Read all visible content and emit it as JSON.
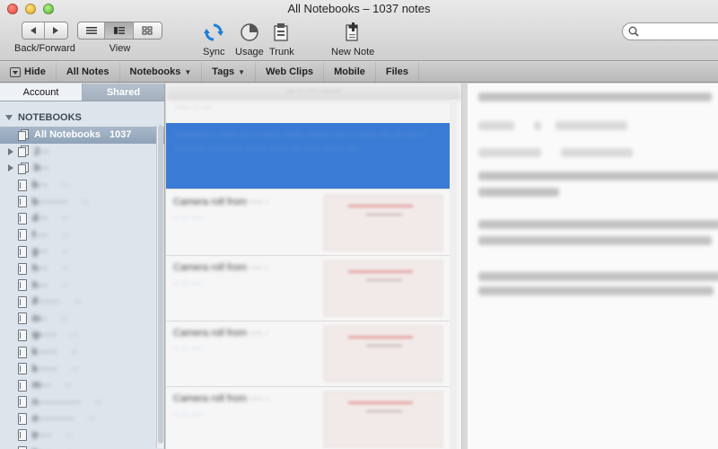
{
  "window": {
    "title": "All Notebooks – 1037 notes"
  },
  "toolbar": {
    "back_forward_label": "Back/Forward",
    "view_label": "View",
    "sync_label": "Sync",
    "usage_label": "Usage",
    "trunk_label": "Trunk",
    "new_note_label": "New Note"
  },
  "tabbar": {
    "hide": "Hide",
    "all_notes": "All Notes",
    "notebooks": "Notebooks",
    "tags": "Tags",
    "web_clips": "Web Clips",
    "mobile": "Mobile",
    "files": "Files"
  },
  "sidebar": {
    "tab_account": "Account",
    "tab_shared": "Shared",
    "section_title": "NOTEBOOKS",
    "selected_notebook": "All Notebooks",
    "selected_count": "1037",
    "notebooks": [
      {
        "name": "2···",
        "count": "",
        "stack": true
      },
      {
        "name": "b···",
        "count": "",
        "stack": true
      },
      {
        "name": "b···",
        "count": "··"
      },
      {
        "name": "b·········",
        "count": "··"
      },
      {
        "name": "d···",
        "count": "··"
      },
      {
        "name": "f····",
        "count": "··"
      },
      {
        "name": "g···",
        "count": "··"
      },
      {
        "name": "h···",
        "count": "··"
      },
      {
        "name": "h···",
        "count": "··"
      },
      {
        "name": "if·······",
        "count": "··"
      },
      {
        "name": "in··",
        "count": "··"
      },
      {
        "name": "ip·····",
        "count": "··"
      },
      {
        "name": "k······",
        "count": "··"
      },
      {
        "name": "k······",
        "count": "··"
      },
      {
        "name": "m···",
        "count": "··"
      },
      {
        "name": "n·············",
        "count": "··"
      },
      {
        "name": "o···········",
        "count": "··"
      },
      {
        "name": "tr····",
        "count": "··"
      },
      {
        "name": "tr····",
        "count": "··"
      }
    ]
  },
  "notelist": {
    "header": "··· ·· ···· ·······",
    "date_group": "····· ·· ····",
    "selected_note_text": "··········· ·· ······ ···· ·· ······ ······· ········ ····· ·· ······ ···· ··· ···· ·· ·········· ·· ········· ······· ······· ··· ······ ···· ·· ····",
    "notes": [
      {
        "title": "Camera roll from ···· ·",
        "sub": "·· ··· ····"
      },
      {
        "title": "Camera roll from ···· ·",
        "sub": "·· ··· ····"
      },
      {
        "title": "Camera roll from ···· ·",
        "sub": "·· ··· ····"
      },
      {
        "title": "Camera roll from ···· ·",
        "sub": "·· ··· ····"
      }
    ]
  },
  "colors": {
    "selection_blue": "#3a7bd5",
    "sidebar_bg": "#dde4ec"
  }
}
